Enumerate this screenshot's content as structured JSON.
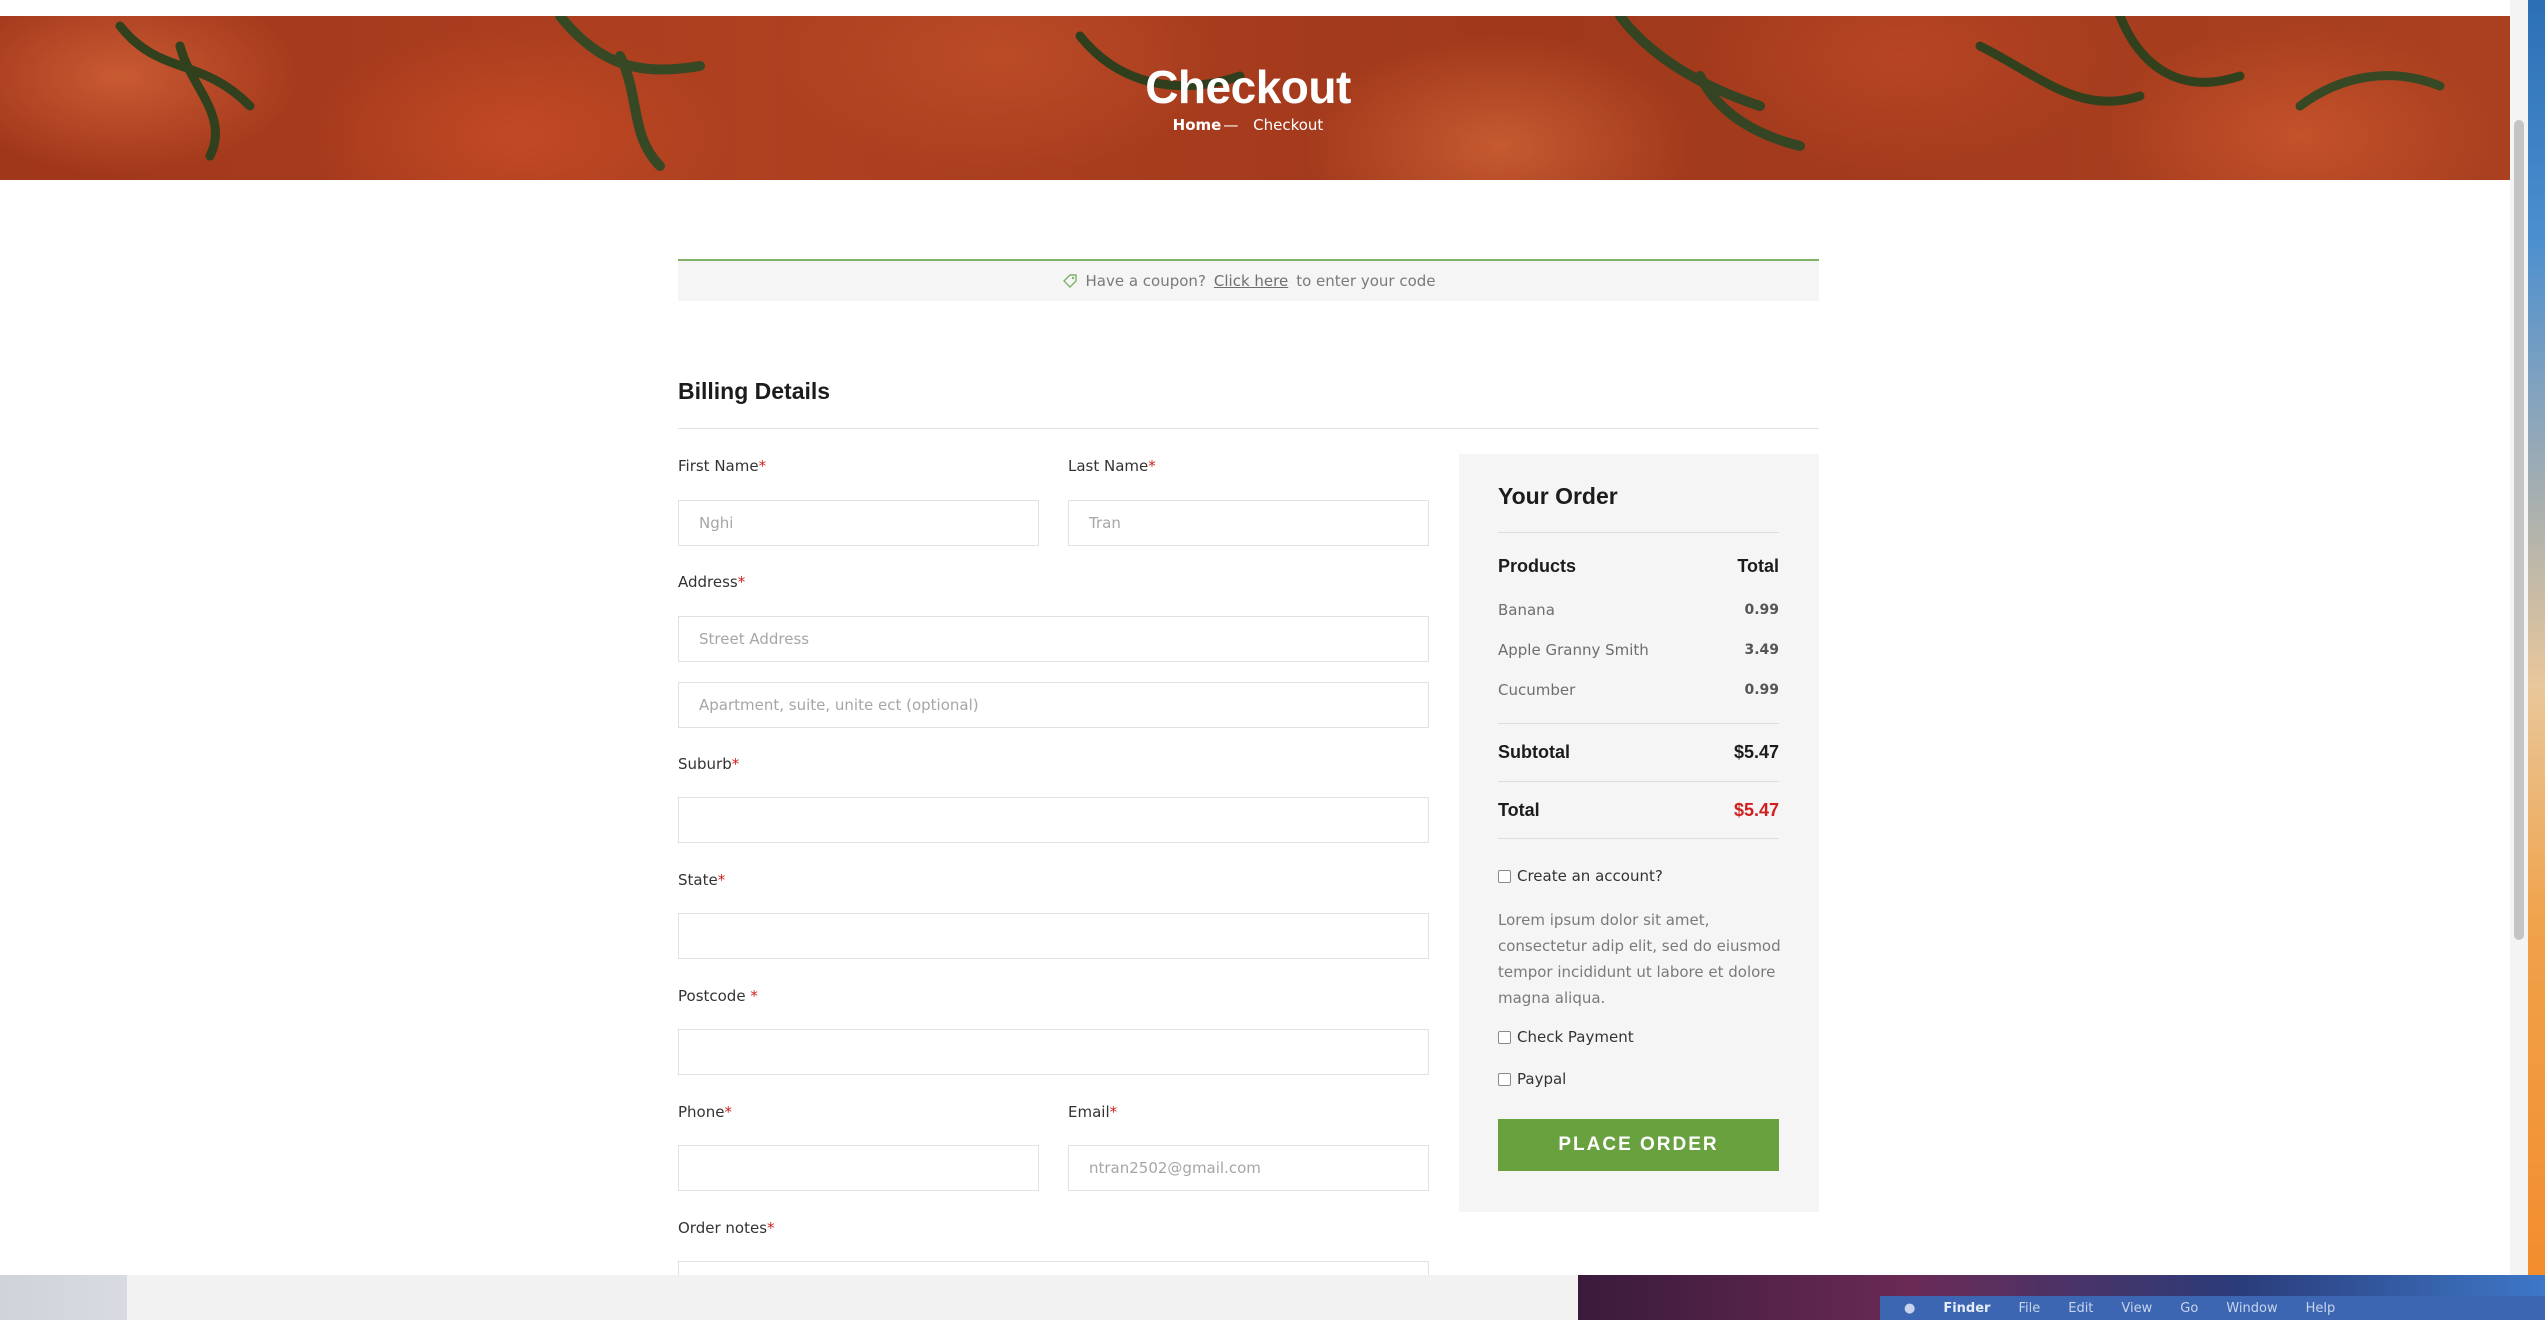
{
  "hero": {
    "title": "Checkout",
    "breadcrumb_home": "Home",
    "breadcrumb_sep": "—",
    "breadcrumb_current": "Checkout"
  },
  "coupon": {
    "prefix": "Have a coupon?",
    "link": "Click here",
    "suffix": "to enter your code",
    "icon": "tag-icon"
  },
  "billing": {
    "title": "Billing Details",
    "required_mark": "*",
    "first_name_label": "First Name",
    "first_name_value": "Nghi",
    "last_name_label": "Last Name",
    "last_name_value": "Tran",
    "address_label": "Address",
    "street_placeholder": "Street Address",
    "apartment_placeholder": "Apartment, suite, unite ect (optional)",
    "suburb_label": "Suburb",
    "state_label": "State",
    "postcode_label": "Postcode ",
    "phone_label": "Phone",
    "email_label": "Email",
    "email_value": "ntran2502@gmail.com",
    "notes_label": "Order notes"
  },
  "order": {
    "title": "Your Order",
    "products_header": "Products",
    "total_header": "Total",
    "items": [
      {
        "name": "Banana",
        "price": "0.99"
      },
      {
        "name": "Apple Granny Smith",
        "price": "3.49"
      },
      {
        "name": "Cucumber",
        "price": "0.99"
      }
    ],
    "subtotal_label": "Subtotal",
    "subtotal_value": "$5.47",
    "total_label": "Total",
    "total_value": "$5.47",
    "create_account_label": "Create an account?",
    "description": "Lorem ipsum dolor sit amet, consectetur adip elit, sed do eiusmod tempor incididunt ut labore et dolore magna aliqua.",
    "check_payment_label": "Check Payment",
    "paypal_label": "Paypal",
    "place_order_label": "PLACE ORDER",
    "accent_color": "#6aa13f",
    "total_color": "#d11f1f"
  },
  "menubar": {
    "app": "Finder",
    "items": [
      "File",
      "Edit",
      "View",
      "Go",
      "Window",
      "Help"
    ]
  }
}
